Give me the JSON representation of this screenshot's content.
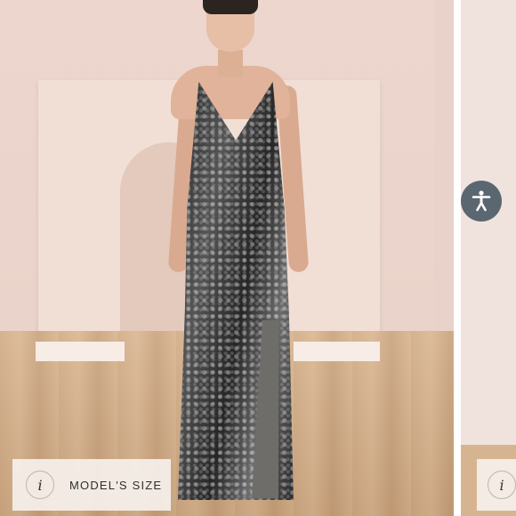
{
  "main_slide": {
    "image_alt": "Model wearing a black sequin gown with side slit"
  },
  "model_size_chip": {
    "info_glyph": "i",
    "label": "MODEL'S SIZE"
  },
  "next_slide": {
    "info_glyph": "i"
  },
  "accessibility": {
    "icon": "accessibility-icon",
    "color": "#5b6770"
  }
}
